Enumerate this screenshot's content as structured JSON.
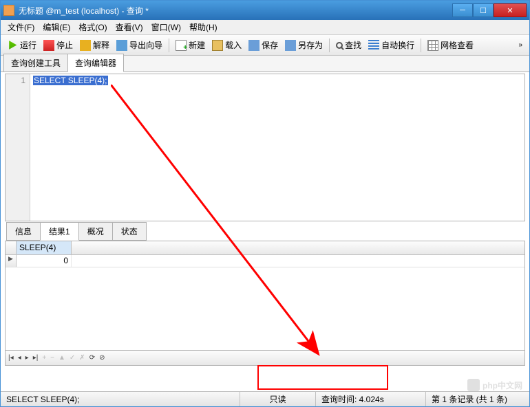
{
  "title": "无标题 @m_test (localhost) - 查询 *",
  "menus": [
    "文件(F)",
    "编辑(E)",
    "格式(O)",
    "查看(V)",
    "窗口(W)",
    "帮助(H)"
  ],
  "toolbar": {
    "run": "运行",
    "stop": "停止",
    "explain": "解释",
    "export_wizard": "导出向导",
    "new": "新建",
    "load": "载入",
    "save": "保存",
    "saveas": "另存为",
    "find": "查找",
    "wrap": "自动换行",
    "grid_view": "网格查看"
  },
  "editor_tabs": {
    "builder": "查询创建工具",
    "editor": "查询编辑器"
  },
  "editor": {
    "line_number": "1",
    "sql": "SELECT SLEEP(4);"
  },
  "result_tabs": {
    "info": "信息",
    "result1": "结果1",
    "profile": "概况",
    "status": "状态"
  },
  "grid": {
    "col1": "SLEEP(4)",
    "row1_val": "0"
  },
  "status": {
    "sql_echo": "SELECT SLEEP(4);",
    "readonly": "只读",
    "query_time": "查询时间: 4.024s",
    "records": "第 1 条记录 (共 1 条)"
  },
  "watermark": "php中文网"
}
